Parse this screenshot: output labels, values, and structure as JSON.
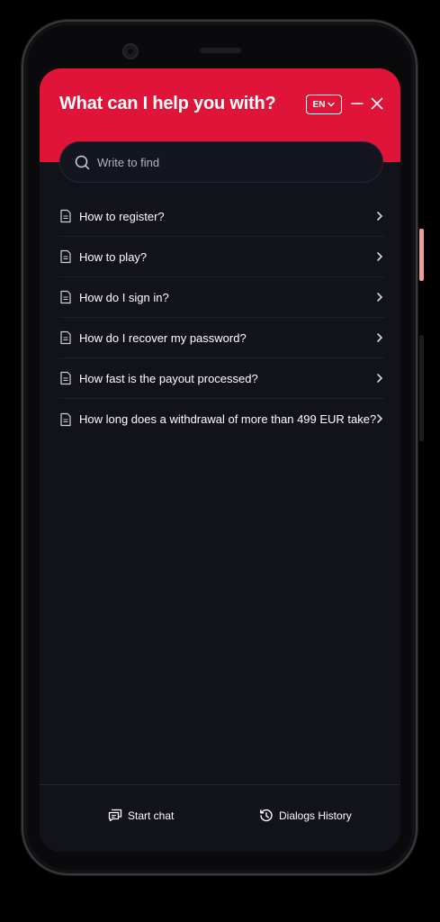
{
  "header": {
    "title": "What can I help you with?",
    "language": "EN",
    "accent_color": "#e01438"
  },
  "search": {
    "placeholder": "Write to find",
    "value": ""
  },
  "faq": [
    {
      "label": "How to register?",
      "icon": "document-icon"
    },
    {
      "label": "How to play?",
      "icon": "document-icon"
    },
    {
      "label": "How do I sign in?",
      "icon": "document-icon"
    },
    {
      "label": "How do I recover my password?",
      "icon": "document-icon"
    },
    {
      "label": "How fast is the payout processed?",
      "icon": "document-icon"
    },
    {
      "label": "How long does a withdrawal of more than 499 EUR take?",
      "icon": "document-icon"
    }
  ],
  "footer": {
    "start_chat": "Start chat",
    "dialogs_history": "Dialogs History"
  },
  "colors": {
    "background": "#12121a",
    "text": "#ffffff"
  }
}
